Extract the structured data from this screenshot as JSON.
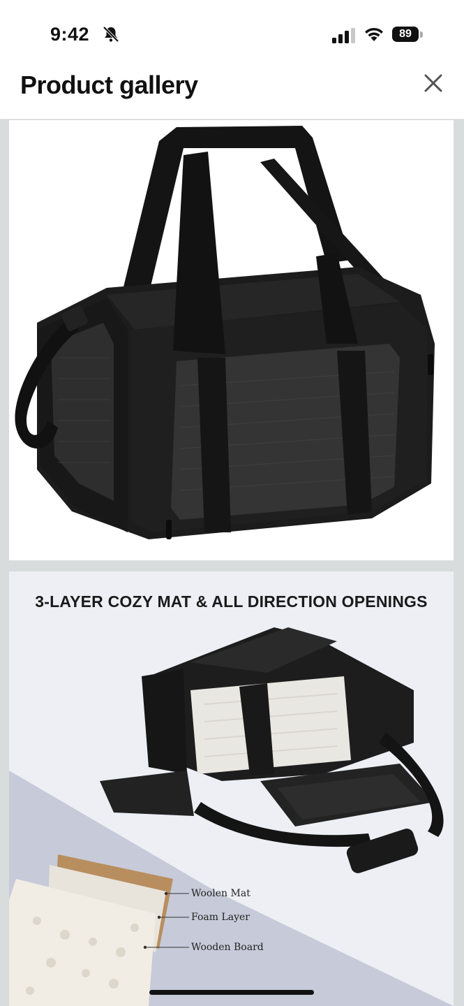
{
  "status_bar": {
    "time": "9:42",
    "battery": "89",
    "icons": [
      "bell-slash-icon",
      "signal-icon",
      "wifi-icon",
      "battery-icon"
    ]
  },
  "header": {
    "title": "Product gallery",
    "close_icon": "close-icon"
  },
  "gallery": {
    "images": [
      {
        "alt_kind": "product-photo-black-pet-carrier"
      },
      {
        "heading": "3-LAYER COZY MAT & ALL DIRECTION OPENINGS",
        "layers": [
          "Woolen Mat",
          "Foam Layer",
          "Wooden Board"
        ]
      }
    ]
  },
  "colors": {
    "background": "#ffffff",
    "gallery_bg": "#d9dcdd",
    "bag": "#1b1b1b",
    "panel_bg": "#edeff5",
    "diag_bg": "#c7cad8"
  }
}
